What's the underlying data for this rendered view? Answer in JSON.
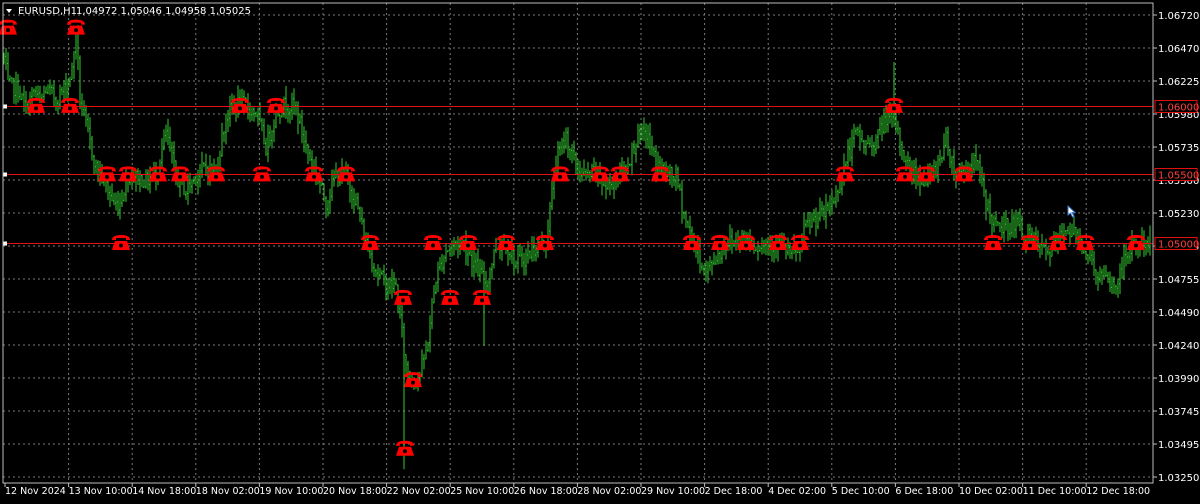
{
  "header": {
    "title": "EURUSD,H1",
    "ohlc": "1,04972 1,05046 1,04958 1,05025"
  },
  "colors": {
    "background": "#000000",
    "grid": "#7a7a7a",
    "bars": "#32cd32",
    "marker": "#ff0000",
    "level_line": "#e01010",
    "level_label_text": "#ff4040",
    "axis_text": "#ffffff",
    "cursor": "#4aa3ff"
  },
  "chart_data": {
    "type": "ohlc",
    "symbol": "EURUSD",
    "timeframe": "H1",
    "ylim": [
      1.0325,
      1.0675
    ],
    "y_ticks": [
      "1.06720",
      "1.06470",
      "1.06225",
      "1.05980",
      "1.05735",
      "1.05500",
      "1.05230",
      "1.04985",
      "1.04755",
      "1.04490",
      "1.04240",
      "1.03990",
      "1.03745",
      "1.03495",
      "1.03250"
    ],
    "x_ticks": [
      "12 Nov 2024",
      "13 Nov 10:00",
      "14 Nov 18:00",
      "18 Nov 02:00",
      "19 Nov 10:00",
      "20 Nov 18:00",
      "22 Nov 02:00",
      "25 Nov 10:00",
      "26 Nov 18:00",
      "28 Nov 02:00",
      "29 Nov 10:00",
      "2 Dec 18:00",
      "4 Dec 02:00",
      "5 Dec 10:00",
      "6 Dec 18:00",
      "10 Dec 02:00",
      "11 Dec 10:00",
      "12 Dec 18:00"
    ],
    "levels": [
      {
        "label": "1.06000",
        "value": 1.06
      },
      {
        "label": "1.05500",
        "value": 1.055
      },
      {
        "label": "1.05000",
        "value": 1.05
      }
    ],
    "anchors": [
      [
        0,
        1.0655
      ],
      [
        8,
        1.0615
      ],
      [
        18,
        1.0612
      ],
      [
        26,
        1.0597
      ],
      [
        30,
        1.0605
      ],
      [
        34,
        1.061
      ],
      [
        40,
        1.0603
      ],
      [
        46,
        1.0612
      ],
      [
        56,
        1.0605
      ],
      [
        64,
        1.0612
      ],
      [
        72,
        1.0625
      ],
      [
        76,
        1.0655
      ],
      [
        80,
        1.0605
      ],
      [
        86,
        1.0585
      ],
      [
        96,
        1.0555
      ],
      [
        106,
        1.0542
      ],
      [
        114,
        1.0528
      ],
      [
        120,
        1.053
      ],
      [
        128,
        1.055
      ],
      [
        136,
        1.0548
      ],
      [
        146,
        1.0545
      ],
      [
        156,
        1.055
      ],
      [
        166,
        1.058
      ],
      [
        176,
        1.0548
      ],
      [
        186,
        1.0538
      ],
      [
        196,
        1.055
      ],
      [
        206,
        1.0555
      ],
      [
        216,
        1.0553
      ],
      [
        226,
        1.0592
      ],
      [
        236,
        1.0602
      ],
      [
        246,
        1.06
      ],
      [
        256,
        1.0595
      ],
      [
        266,
        1.057
      ],
      [
        276,
        1.0595
      ],
      [
        286,
        1.0602
      ],
      [
        296,
        1.0598
      ],
      [
        306,
        1.057
      ],
      [
        316,
        1.055
      ],
      [
        326,
        1.053
      ],
      [
        336,
        1.055
      ],
      [
        346,
        1.0548
      ],
      [
        356,
        1.053
      ],
      [
        366,
        1.05
      ],
      [
        376,
        1.048
      ],
      [
        386,
        1.047
      ],
      [
        396,
        1.0468
      ],
      [
        406,
        1.041
      ],
      [
        412,
        1.04
      ],
      [
        420,
        1.0405
      ],
      [
        426,
        1.042
      ],
      [
        436,
        1.0475
      ],
      [
        446,
        1.0495
      ],
      [
        456,
        1.05
      ],
      [
        464,
        1.05
      ],
      [
        474,
        1.0485
      ],
      [
        486,
        1.047
      ],
      [
        496,
        1.0498
      ],
      [
        506,
        1.05
      ],
      [
        516,
        1.0485
      ],
      [
        526,
        1.049
      ],
      [
        536,
        1.0497
      ],
      [
        546,
        1.05
      ],
      [
        556,
        1.056
      ],
      [
        566,
        1.0578
      ],
      [
        576,
        1.0555
      ],
      [
        586,
        1.0548
      ],
      [
        596,
        1.0552
      ],
      [
        606,
        1.054
      ],
      [
        616,
        1.0548
      ],
      [
        626,
        1.0555
      ],
      [
        636,
        1.0575
      ],
      [
        646,
        1.058
      ],
      [
        656,
        1.0558
      ],
      [
        666,
        1.055
      ],
      [
        676,
        1.0548
      ],
      [
        686,
        1.0515
      ],
      [
        696,
        1.0495
      ],
      [
        706,
        1.0478
      ],
      [
        716,
        1.049
      ],
      [
        726,
        1.05
      ],
      [
        736,
        1.0502
      ],
      [
        746,
        1.0505
      ],
      [
        756,
        1.0498
      ],
      [
        766,
        1.05
      ],
      [
        776,
        1.05
      ],
      [
        786,
        1.0495
      ],
      [
        796,
        1.049
      ],
      [
        806,
        1.0512
      ],
      [
        816,
        1.0518
      ],
      [
        826,
        1.0522
      ],
      [
        836,
        1.0535
      ],
      [
        846,
        1.056
      ],
      [
        856,
        1.058
      ],
      [
        866,
        1.057
      ],
      [
        876,
        1.0575
      ],
      [
        886,
        1.0592
      ],
      [
        896,
        1.0585
      ],
      [
        906,
        1.0558
      ],
      [
        916,
        1.055
      ],
      [
        926,
        1.0545
      ],
      [
        936,
        1.0555
      ],
      [
        946,
        1.0575
      ],
      [
        956,
        1.055
      ],
      [
        966,
        1.0555
      ],
      [
        976,
        1.056
      ],
      [
        986,
        1.053
      ],
      [
        996,
        1.051
      ],
      [
        1006,
        1.0512
      ],
      [
        1016,
        1.0515
      ],
      [
        1026,
        1.0505
      ],
      [
        1036,
        1.05
      ],
      [
        1046,
        1.0492
      ],
      [
        1056,
        1.0498
      ],
      [
        1066,
        1.0512
      ],
      [
        1076,
        1.0505
      ],
      [
        1086,
        1.0495
      ],
      [
        1096,
        1.0478
      ],
      [
        1106,
        1.0472
      ],
      [
        1116,
        1.0468
      ],
      [
        1126,
        1.049
      ],
      [
        1136,
        1.05
      ],
      [
        1146,
        1.0499
      ],
      [
        1152,
        1.05
      ]
    ],
    "spikes": [
      [
        77,
        1.0665,
        null
      ],
      [
        404,
        null,
        1.0335
      ],
      [
        484,
        null,
        1.0425
      ],
      [
        894,
        1.0632,
        null
      ],
      [
        1133,
        1.052,
        null
      ]
    ],
    "markers": [
      [
        8,
        1.0657
      ],
      [
        36,
        1.06
      ],
      [
        70,
        1.06
      ],
      [
        76,
        1.0657
      ],
      [
        107,
        1.055
      ],
      [
        128,
        1.055
      ],
      [
        158,
        1.055
      ],
      [
        180,
        1.055
      ],
      [
        216,
        1.055
      ],
      [
        240,
        1.06
      ],
      [
        276,
        1.06
      ],
      [
        262,
        1.055
      ],
      [
        314,
        1.055
      ],
      [
        346,
        1.055
      ],
      [
        121,
        1.05
      ],
      [
        370,
        1.05
      ],
      [
        433,
        1.05
      ],
      [
        468,
        1.05
      ],
      [
        506,
        1.05
      ],
      [
        545,
        1.05
      ],
      [
        403,
        1.046
      ],
      [
        450,
        1.046
      ],
      [
        482,
        1.046
      ],
      [
        413,
        1.04
      ],
      [
        405,
        1.035
      ],
      [
        560,
        1.055
      ],
      [
        600,
        1.055
      ],
      [
        620,
        1.055
      ],
      [
        660,
        1.055
      ],
      [
        692,
        1.05
      ],
      [
        720,
        1.05
      ],
      [
        746,
        1.05
      ],
      [
        778,
        1.05
      ],
      [
        800,
        1.05
      ],
      [
        845,
        1.055
      ],
      [
        894,
        1.06
      ],
      [
        905,
        1.055
      ],
      [
        926,
        1.055
      ],
      [
        964,
        1.055
      ],
      [
        993,
        1.05
      ],
      [
        1030,
        1.05
      ],
      [
        1058,
        1.05
      ],
      [
        1085,
        1.05
      ],
      [
        1136,
        1.05
      ]
    ]
  }
}
